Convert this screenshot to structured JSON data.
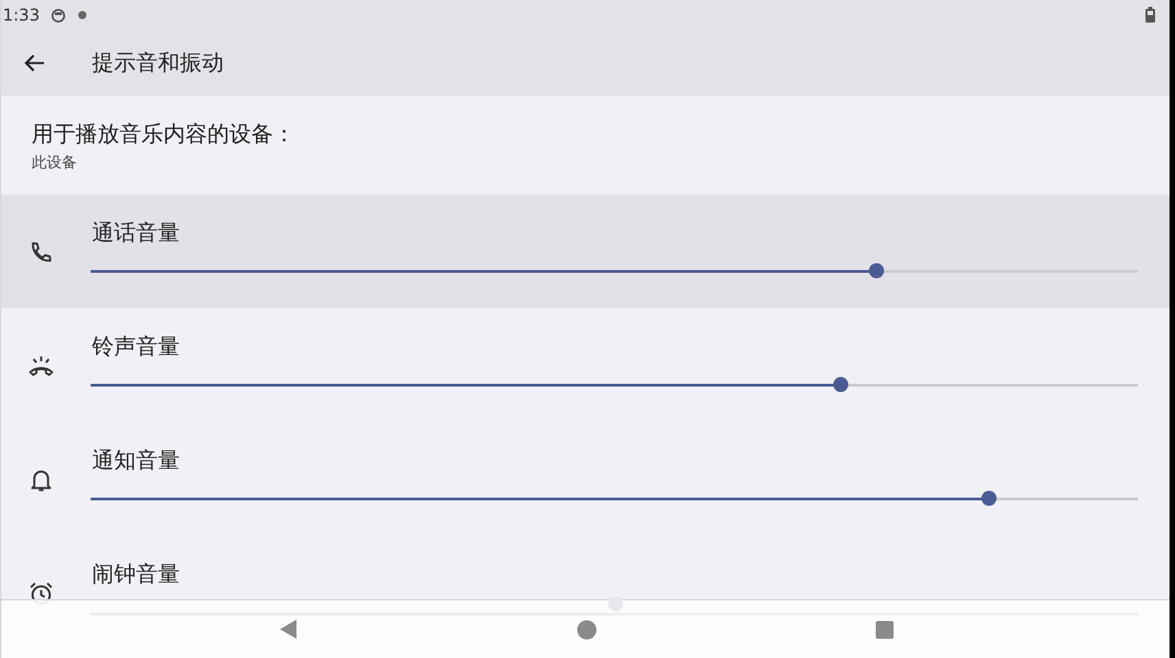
{
  "status_bar": {
    "time": "1:33"
  },
  "app_bar": {
    "title": "提示音和振动"
  },
  "output_device": {
    "label": "用于播放音乐内容的设备：",
    "value": "此设备"
  },
  "volumes": [
    {
      "kind": "call",
      "label": "通话音量",
      "level": 0.75,
      "focused": true
    },
    {
      "kind": "ring",
      "label": "铃声音量",
      "level": 0.715,
      "focused": false
    },
    {
      "kind": "notification",
      "label": "通知音量",
      "level": 0.857,
      "focused": false
    },
    {
      "kind": "alarm",
      "label": "闹钟音量",
      "level": 0.5,
      "focused": false
    }
  ]
}
